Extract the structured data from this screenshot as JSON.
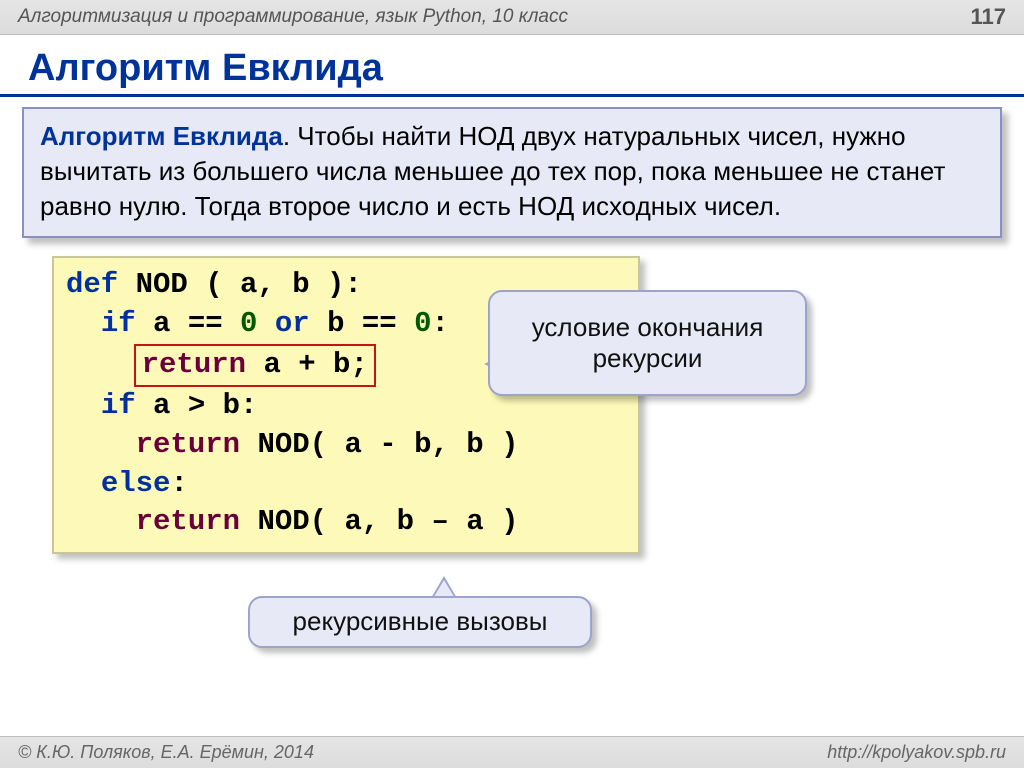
{
  "header": {
    "breadcrumb": "Алгоритмизация и программирование, язык Python, 10 класс",
    "page": "117"
  },
  "title": "Алгоритм Евклида",
  "info": {
    "lead": "Алгоритм Евклида",
    "body": ". Чтобы найти НОД двух натуральных чисел, нужно вычитать из большего числа меньшее до тех пор, пока меньшее не станет равно нулю. Тогда второе число и есть НОД исходных чисел."
  },
  "code": {
    "l1": {
      "def": "def",
      "name": " NOD ( a, b ):"
    },
    "l2": {
      "if": "if",
      "a": " a",
      "eq1": " ==",
      "z1": " 0 ",
      "or": "or",
      "b": " b",
      "eq2": " ==",
      "z2": " 0",
      "colon": ":"
    },
    "l3": {
      "ret": "return",
      "expr": " a + b;"
    },
    "l4": {
      "if": "if",
      "cond": " a > b:"
    },
    "l5": {
      "ret": "return",
      "call": " NOD( a - b, b )"
    },
    "l6": {
      "else": "else",
      "colon": ":"
    },
    "l7": {
      "ret": "return",
      "call": " NOD( a, b – a )"
    }
  },
  "callouts": {
    "c1": "условие окончания рекурсии",
    "c2": "рекурсивные вызовы"
  },
  "footer": {
    "left": "© К.Ю. Поляков, Е.А. Ерёмин, 2014",
    "right": "http://kpolyakov.spb.ru"
  }
}
